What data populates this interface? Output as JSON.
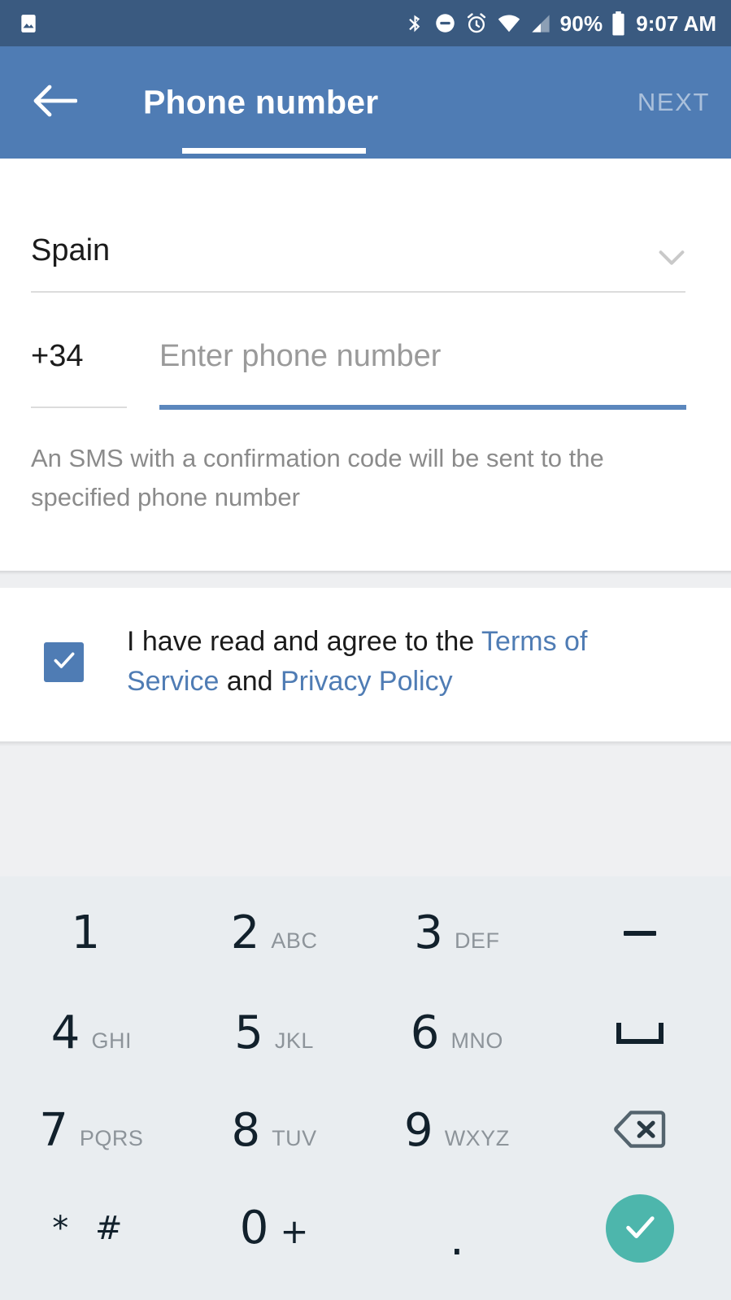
{
  "statusbar": {
    "battery_percent": "90%",
    "clock": "9:07 AM",
    "icons": [
      "image-icon",
      "bluetooth-icon",
      "do-not-disturb-icon",
      "alarm-icon",
      "wifi-icon",
      "cellular-signal-icon",
      "battery-icon"
    ]
  },
  "appbar": {
    "back_icon": "arrow-back-icon",
    "title": "Phone number",
    "next_label": "NEXT"
  },
  "form": {
    "country_label": "Spain",
    "country_chevron_icon": "chevron-down-icon",
    "country_code": "+34",
    "phone_placeholder": "Enter phone number",
    "phone_value": "",
    "hint": "An SMS with a confirmation code will be sent to the specified phone number"
  },
  "terms": {
    "checked": true,
    "check_icon": "check-icon",
    "prefix": "I have read and agree to the ",
    "link_tos": "Terms of Service",
    "conjunction": " and ",
    "link_privacy": "Privacy Policy"
  },
  "keyboard": {
    "rows": [
      [
        {
          "digit": "1",
          "letters": "",
          "type": "digit"
        },
        {
          "digit": "2",
          "letters": "ABC",
          "type": "digit"
        },
        {
          "digit": "3",
          "letters": "DEF",
          "type": "digit"
        },
        {
          "digit": "",
          "letters": "",
          "type": "dash",
          "icon": "dash-icon"
        }
      ],
      [
        {
          "digit": "4",
          "letters": "GHI",
          "type": "digit"
        },
        {
          "digit": "5",
          "letters": "JKL",
          "type": "digit"
        },
        {
          "digit": "6",
          "letters": "MNO",
          "type": "digit"
        },
        {
          "digit": "",
          "letters": "",
          "type": "space",
          "icon": "space-icon"
        }
      ],
      [
        {
          "digit": "7",
          "letters": "PQRS",
          "type": "digit"
        },
        {
          "digit": "8",
          "letters": "TUV",
          "type": "digit"
        },
        {
          "digit": "9",
          "letters": "WXYZ",
          "type": "digit"
        },
        {
          "digit": "",
          "letters": "",
          "type": "backspace",
          "icon": "backspace-icon"
        }
      ],
      [
        {
          "digit": "",
          "letters": "",
          "type": "star",
          "label": "* #"
        },
        {
          "digit": "0",
          "letters": "+",
          "type": "digit"
        },
        {
          "digit": "",
          "letters": "",
          "type": "dot",
          "label": "."
        },
        {
          "digit": "",
          "letters": "",
          "type": "enter",
          "icon": "check-icon"
        }
      ]
    ]
  },
  "colors": {
    "statusbar_bg": "#3A5A80",
    "appbar_bg": "#4F7CB4",
    "accent_blue": "#4F7CB4",
    "focus_underline": "#5B87BD",
    "keyboard_bg": "#E9EDF0",
    "enter_teal": "#4DB6AC",
    "hint_gray": "#8B8B8B",
    "key_letters_gray": "#8D949A"
  }
}
